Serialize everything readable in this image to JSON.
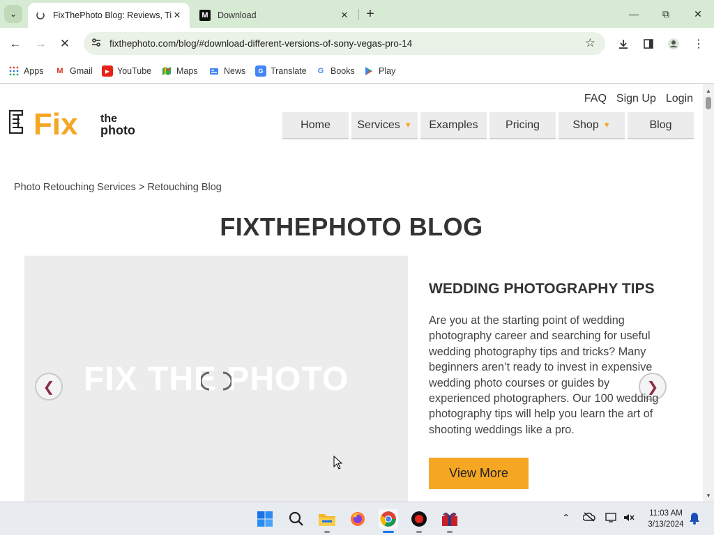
{
  "browser": {
    "tabs": [
      {
        "title": "FixThePhoto Blog: Reviews, Tips",
        "active": true
      },
      {
        "title": "Download",
        "active": false
      }
    ],
    "url": "fixthephoto.com/blog/#download-different-versions-of-sony-vegas-pro-14",
    "bookmarks": [
      "Apps",
      "Gmail",
      "YouTube",
      "Maps",
      "News",
      "Translate",
      "Books",
      "Play"
    ]
  },
  "site": {
    "logo_fix": "Fix",
    "logo_the": "the",
    "logo_photo": "photo",
    "top_links": [
      "FAQ",
      "Sign Up",
      "Login"
    ],
    "menu": [
      {
        "label": "Home",
        "dropdown": false
      },
      {
        "label": "Services",
        "dropdown": true
      },
      {
        "label": "Examples",
        "dropdown": false
      },
      {
        "label": "Pricing",
        "dropdown": false
      },
      {
        "label": "Shop",
        "dropdown": true
      },
      {
        "label": "Blog",
        "dropdown": false
      }
    ],
    "breadcrumb": {
      "first": "Photo Retouching Services",
      "separator": ">",
      "second": "Retouching Blog"
    },
    "page_title": "FIXTHEPHOTO BLOG",
    "slider": {
      "watermark": "FIX THE PHOTO",
      "post_title": "WEDDING PHOTOGRAPHY TIPS",
      "post_text": "Are you at the starting point of wedding photography career and searching for useful wedding photography tips and tricks? Many beginners aren’t ready to invest in expensive wedding photo  courses or guides by experienced photographers. Our 100 wedding photography tips will help you learn the art of shooting weddings like a pro.",
      "cta": "View More"
    }
  },
  "taskbar": {
    "time": "11:03 AM",
    "date": "3/13/2024"
  },
  "colors": {
    "accent_orange": "#f5a623",
    "chrome_green": "#d7ead3",
    "arrow_maroon": "#8b2d45"
  }
}
